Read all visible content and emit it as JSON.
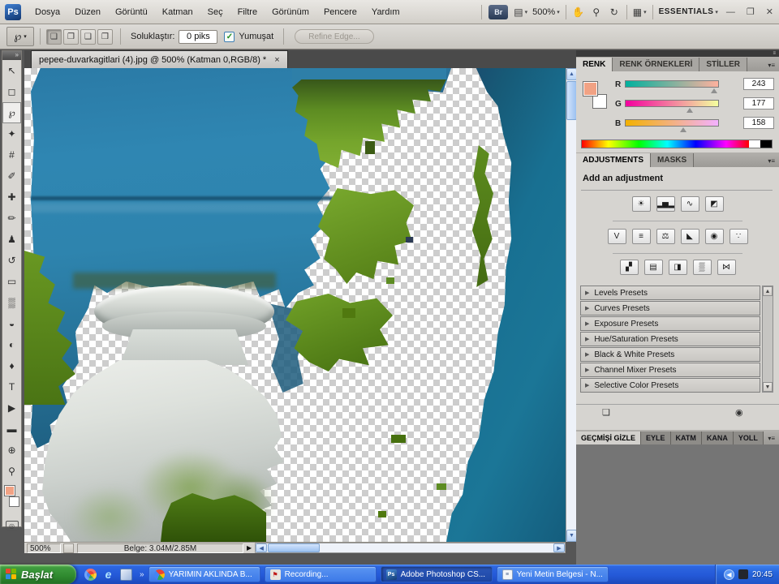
{
  "window_controls": {
    "minimize": "—",
    "restore": "❐",
    "close": "✕"
  },
  "menu_bar": {
    "logo": "Ps",
    "items": [
      "Dosya",
      "Düzen",
      "Görüntü",
      "Katman",
      "Seç",
      "Filtre",
      "Görünüm",
      "Pencere",
      "Yardım"
    ],
    "bridge_label": "Br",
    "zoom_level": "500%",
    "workspace_label": "ESSENTIALS",
    "dropdown_arrow": "▼"
  },
  "options_bar": {
    "tool_glyph": "℘",
    "mode_glyphs": [
      "❏",
      "❐",
      "❑",
      "❒"
    ],
    "feather_label": "Soluklaştır:",
    "feather_value": "0 piks",
    "checkmark": "✓",
    "antialias_label": "Yumuşat",
    "refine_edge_label": "Refine Edge..."
  },
  "document_tab": {
    "title": "pepee-duvarkagitlari (4).jpg @ 500% (Katman 0,RGB/8) *",
    "close_glyph": "×"
  },
  "tools": [
    {
      "name": "move-tool",
      "glyph": "↖"
    },
    {
      "name": "marquee-tool",
      "glyph": "◻"
    },
    {
      "name": "lasso-tool",
      "glyph": "℘"
    },
    {
      "name": "quick-selection-tool",
      "glyph": "✦"
    },
    {
      "name": "crop-tool",
      "glyph": "#"
    },
    {
      "name": "eyedropper-tool",
      "glyph": "✐"
    },
    {
      "name": "healing-brush-tool",
      "glyph": "✚"
    },
    {
      "name": "brush-tool",
      "glyph": "✏"
    },
    {
      "name": "clone-stamp-tool",
      "glyph": "♟"
    },
    {
      "name": "history-brush-tool",
      "glyph": "↺"
    },
    {
      "name": "eraser-tool",
      "glyph": "▭"
    },
    {
      "name": "gradient-tool",
      "glyph": "▒"
    },
    {
      "name": "blur-tool",
      "glyph": "◒"
    },
    {
      "name": "dodge-tool",
      "glyph": "◐"
    },
    {
      "name": "pen-tool",
      "glyph": "♦"
    },
    {
      "name": "type-tool",
      "glyph": "T"
    },
    {
      "name": "path-selection-tool",
      "glyph": "▶"
    },
    {
      "name": "shape-tool",
      "glyph": "▬"
    },
    {
      "name": "rotate-view-tool",
      "glyph": "⊕"
    },
    {
      "name": "zoom-tool",
      "glyph": "⚲"
    }
  ],
  "color_panel": {
    "tabs": [
      "RENK",
      "RENK ÖRNEKLERİ",
      "STİLLER"
    ],
    "channels": [
      {
        "label": "R",
        "value": "243"
      },
      {
        "label": "G",
        "value": "177"
      },
      {
        "label": "B",
        "value": "158"
      }
    ],
    "foreground_color": "#f1a284",
    "background_color": "#ffffff"
  },
  "adjustments_panel": {
    "tabs": [
      "ADJUSTMENTS",
      "MASKS"
    ],
    "heading": "Add an adjustment",
    "icons_row1": [
      {
        "name": "brightness-contrast-icon",
        "glyph": "☀"
      },
      {
        "name": "levels-icon",
        "glyph": "▂▅▂"
      },
      {
        "name": "curves-icon",
        "glyph": "∿"
      },
      {
        "name": "exposure-icon",
        "glyph": "◩"
      }
    ],
    "icons_row2": [
      {
        "name": "vibrance-icon",
        "glyph": "V"
      },
      {
        "name": "hue-saturation-icon",
        "glyph": "≡"
      },
      {
        "name": "color-balance-icon",
        "glyph": "⚖"
      },
      {
        "name": "black-white-icon",
        "glyph": "◣"
      },
      {
        "name": "photo-filter-icon",
        "glyph": "◉"
      },
      {
        "name": "channel-mixer-icon",
        "glyph": "∵"
      }
    ],
    "icons_row3": [
      {
        "name": "invert-icon",
        "glyph": "▞"
      },
      {
        "name": "posterize-icon",
        "glyph": "▤"
      },
      {
        "name": "threshold-icon",
        "glyph": "◨"
      },
      {
        "name": "gradient-map-icon",
        "glyph": "▒"
      },
      {
        "name": "selective-color-icon",
        "glyph": "⋈"
      }
    ],
    "preset_arrow": "▶",
    "presets": [
      "Levels Presets",
      "Curves Presets",
      "Exposure Presets",
      "Hue/Saturation Presets",
      "Black & White Presets",
      "Channel Mixer Presets",
      "Selective Color Presets"
    ]
  },
  "history_panel": {
    "active_tab": "GEÇMİŞİ GİZLE",
    "tabs": [
      "EYLE",
      "KATM",
      "KANA",
      "YOLL"
    ]
  },
  "status_bar": {
    "zoom": "500%",
    "doc_size": "Belge: 3.04M/2.85M",
    "flyout_glyph": "▶"
  },
  "taskbar": {
    "start_label": "Başlat",
    "overflow_glyph": "»",
    "buttons": [
      {
        "label": "YARIMIN AKLINDA B..."
      },
      {
        "label": "Recording..."
      },
      {
        "label": "Adobe Photoshop CS..."
      },
      {
        "label": "Yeni Metin Belgesi - N..."
      }
    ],
    "tray_time": "20:45"
  }
}
